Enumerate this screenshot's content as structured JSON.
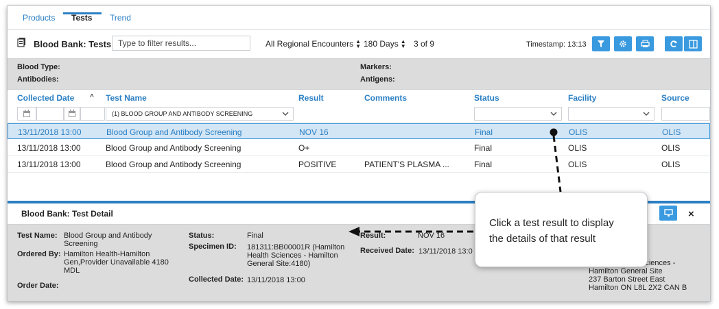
{
  "tabs": [
    {
      "label": "Products"
    },
    {
      "label": "Tests"
    },
    {
      "label": "Trend"
    }
  ],
  "toolbar": {
    "title": "Blood Bank: Tests",
    "filter_placeholder": "Type to filter results...",
    "encounters_select": "All Regional Encounters",
    "days_select": "180 Days",
    "page_count": "3 of 9",
    "timestamp": "Timestamp: 13:13"
  },
  "info": {
    "blood_type_label": "Blood Type:",
    "antibodies_label": "Antibodies:",
    "markers_label": "Markers:",
    "antigens_label": "Antigens:"
  },
  "grid": {
    "headers": {
      "collected_date": "Collected Date",
      "sort_indicator": "˄",
      "test_name": "Test Name",
      "result": "Result",
      "comments": "Comments",
      "status": "Status",
      "facility": "Facility",
      "source": "Source"
    },
    "test_filter_value": "(1) BLOOD GROUP AND ANTIBODY SCREENING",
    "rows": [
      {
        "date": "13/11/2018 13:00",
        "test": "Blood Group and Antibody Screening",
        "result": "NOV 16",
        "comments": "",
        "status": "Final",
        "facility": "OLIS",
        "source": "OLIS"
      },
      {
        "date": "13/11/2018 13:00",
        "test": "Blood Group and Antibody Screening",
        "result": "O+",
        "comments": "",
        "status": "Final",
        "facility": "OLIS",
        "source": "OLIS"
      },
      {
        "date": "13/11/2018 13:00",
        "test": "Blood Group and Antibody Screening",
        "result": "POSITIVE",
        "comments": "PATIENT'S PLASMA ...",
        "status": "Final",
        "facility": "OLIS",
        "source": "OLIS"
      }
    ]
  },
  "detail": {
    "title": "Blood Bank: Test Detail",
    "test_name_label": "Test Name:",
    "test_name_value1": "Blood Group and Antibody",
    "test_name_value2": "Screening",
    "ordered_by_label": "Ordered By:",
    "ordered_by_value1": "Hamilton Health-Hamilton",
    "ordered_by_value2": "Gen,Provider Unavailable  4180",
    "ordered_by_value3": "MDL",
    "order_date_label": "Order Date:",
    "status_label": "Status:",
    "status_value": "Final",
    "specimen_label": "Specimen ID:",
    "specimen_value1": "181311:BB00001R (Hamilton",
    "specimen_value2": "Health Sciences - Hamilton",
    "specimen_value3": "General Site:4180)",
    "collected_label": "Collected Date:",
    "collected_value": "13/11/2018 13:00",
    "result_label": "Result:",
    "result_value": "NOV 16",
    "received_label": "Received Date:",
    "received_value": "13/11/2018 13:0",
    "facility_line1": "Sciences -",
    "facility_line2": "Hamilton General Site",
    "facility_line3": "237 Barton Street East",
    "facility_line4": "Hamilton ON L8L 2X2 CAN B"
  },
  "callout": {
    "line1": "Click a test result to display",
    "line2": "the details of that result"
  },
  "colors": {
    "accent": "#2a7fc4",
    "button": "#3a9ae0",
    "selected_row": "#d3e6f6",
    "panel_gray": "#dcdcdc"
  },
  "icons": [
    "document-icon",
    "filter-icon",
    "gear-icon",
    "print-icon",
    "refresh-icon",
    "columns-icon",
    "calendar-icon",
    "chevron-down-icon",
    "monitor-icon",
    "close-icon"
  ]
}
